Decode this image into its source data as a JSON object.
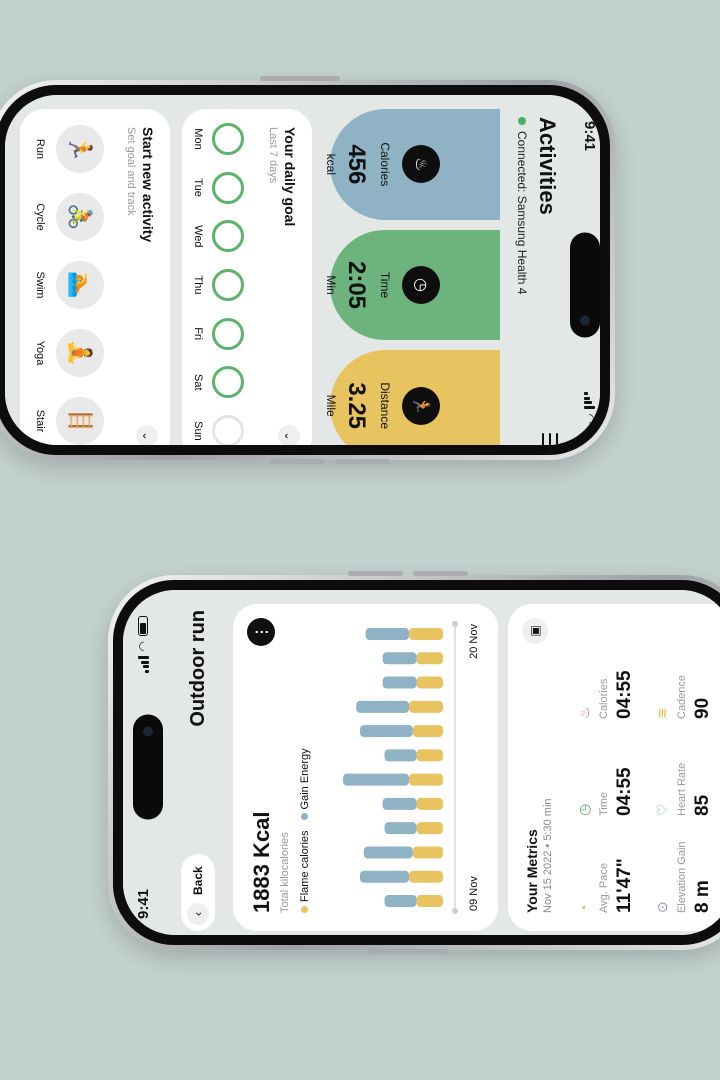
{
  "colors": {
    "calories": "#8fb3c4",
    "time": "#6db37e",
    "distance": "#e8c461",
    "flame": "#e8c461",
    "gain": "#8fb3c4",
    "ring": "#5db36b"
  },
  "phone1": {
    "status": {
      "time": "9:41"
    },
    "header": {
      "title": "Activities",
      "connected": "Connected: Samsung Health 4",
      "menu_icon": "menu-icon"
    },
    "stats": [
      {
        "label": "Calories",
        "value": "456",
        "unit": "kcal",
        "icon": "flame-icon"
      },
      {
        "label": "Time",
        "value": "2:05",
        "unit": "Min",
        "icon": "clock-icon"
      },
      {
        "label": "Distance",
        "value": "3.25",
        "unit": "Mile",
        "icon": "runner-icon"
      }
    ],
    "goal": {
      "title": "Your daily goal",
      "subtitle": "Last 7 days",
      "days": [
        {
          "label": "Mon",
          "done": true
        },
        {
          "label": "Tue",
          "done": true
        },
        {
          "label": "Wed",
          "done": true
        },
        {
          "label": "Thu",
          "done": true
        },
        {
          "label": "Fri",
          "done": true
        },
        {
          "label": "Sat",
          "done": true
        },
        {
          "label": "Sun",
          "done": false
        }
      ]
    },
    "activity": {
      "title": "Start new activity",
      "subtitle": "Set goal and track",
      "items": [
        {
          "label": "Run",
          "icon": "run-icon"
        },
        {
          "label": "Cycle",
          "icon": "cycle-icon"
        },
        {
          "label": "Swim",
          "icon": "swim-icon"
        },
        {
          "label": "Yoga",
          "icon": "yoga-icon"
        },
        {
          "label": "Stair",
          "icon": "stair-icon"
        }
      ]
    }
  },
  "phone2": {
    "status": {
      "time": "9:41"
    },
    "nav": {
      "back_label": "Back",
      "title": "Outdoor run"
    },
    "summary": {
      "value": "1883 Kcal",
      "label": "Total kilocalories",
      "legend": [
        "Flame calories",
        "Gain Energy"
      ]
    },
    "chart_data": {
      "type": "bar",
      "stacked": true,
      "x_start_label": "09 Nov",
      "x_end_label": "20 Nov",
      "series": [
        {
          "name": "Flame calories",
          "values": [
            14,
            18,
            16,
            14,
            14,
            18,
            14,
            16,
            18,
            14,
            14,
            18
          ]
        },
        {
          "name": "Gain Energy",
          "values": [
            17,
            26,
            26,
            17,
            18,
            35,
            17,
            28,
            28,
            18,
            18,
            23
          ]
        }
      ]
    },
    "metrics": {
      "title": "Your Metrics",
      "subtitle": "Nov 15 2022 • 5:30 min",
      "items": [
        {
          "label": "Avg. Pace",
          "value": "11'47\"",
          "icon": "pace-icon"
        },
        {
          "label": "Time",
          "value": "04:55",
          "icon": "clock-icon"
        },
        {
          "label": "Calories",
          "value": "04:55",
          "icon": "flame-icon"
        },
        {
          "label": "Elevation Gain",
          "value": "8 m",
          "icon": "elevation-icon"
        },
        {
          "label": "Heart Rate",
          "value": "85",
          "icon": "heart-icon"
        },
        {
          "label": "Cadence",
          "value": "90",
          "icon": "cadence-icon"
        }
      ]
    }
  }
}
